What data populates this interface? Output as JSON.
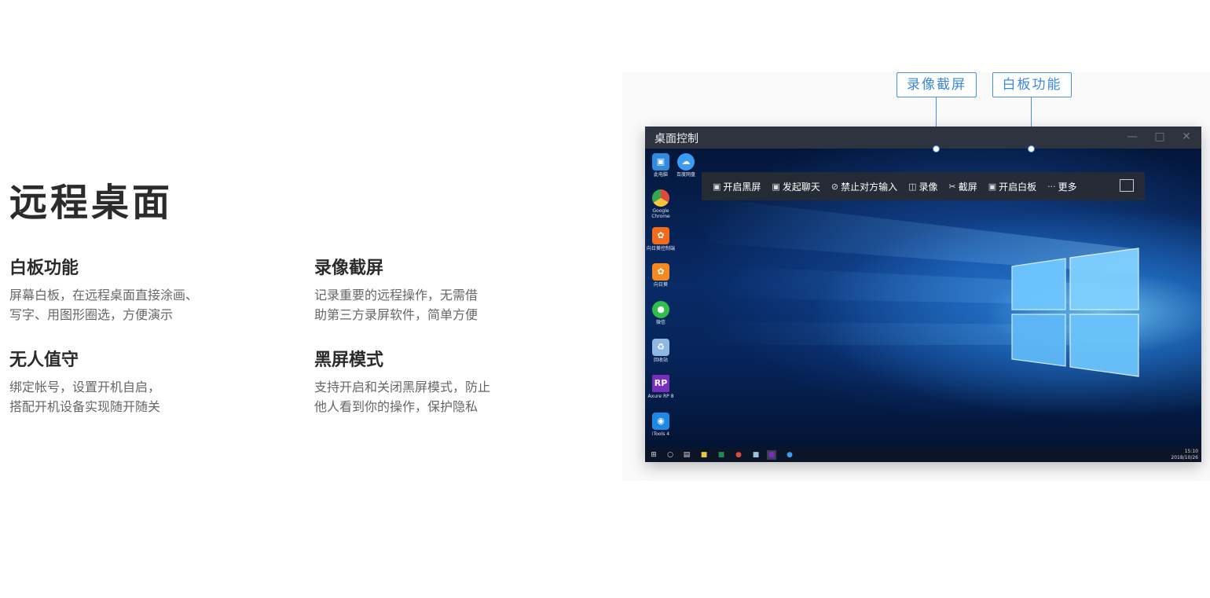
{
  "hero": {
    "title": "远程桌面"
  },
  "features": [
    {
      "title": "白板功能",
      "lines": [
        "屏幕白板，在远程桌面直接涂画、",
        "写字、用图形圈选，方便演示"
      ]
    },
    {
      "title": "录像截屏",
      "lines": [
        "记录重要的远程操作，无需借",
        "助第三方录屏软件，简单方便"
      ]
    },
    {
      "title": "无人值守",
      "lines": [
        "绑定帐号，设置开机自启，",
        "搭配开机设备实现随开随关"
      ]
    },
    {
      "title": "黑屏模式",
      "lines": [
        "支持开启和关闭黑屏模式，防止",
        "他人看到你的操作，保护隐私"
      ]
    }
  ],
  "callouts": {
    "record": "录像截屏",
    "whiteboard": "白板功能"
  },
  "window": {
    "title": "桌面控制",
    "toolbar": [
      {
        "label": "开启黑屏",
        "icon": "screen-icon"
      },
      {
        "label": "发起聊天",
        "icon": "chat-icon"
      },
      {
        "label": "禁止对方输入",
        "icon": "block-input-icon"
      },
      {
        "label": "录像",
        "icon": "camera-icon"
      },
      {
        "label": "截屏",
        "icon": "scissors-icon"
      },
      {
        "label": "开启白板",
        "icon": "whiteboard-icon"
      },
      {
        "label": "更多",
        "icon": "more-icon"
      }
    ]
  },
  "desktop_icons": [
    {
      "label": "此电脑",
      "color": "#2f8be0",
      "icon": "computer-icon"
    },
    {
      "label": "百度网盘",
      "color": "#3b9cf5",
      "icon": "cloud-icon"
    },
    {
      "label": "Google Chrome",
      "color": "#e04a3a",
      "icon": "chrome-icon"
    },
    {
      "label": "向日葵控制端",
      "color": "#f26b1d",
      "icon": "sunflower-icon"
    },
    {
      "label": "向日葵",
      "color": "#f48a1f",
      "icon": "sunflower-icon"
    },
    {
      "label": "微信",
      "color": "#2fbf4a",
      "icon": "wechat-icon"
    },
    {
      "label": "回收站",
      "color": "#8fb9e0",
      "icon": "recycle-bin-icon"
    },
    {
      "label": "Axure RP 8",
      "color": "#7a2dbd",
      "icon": "axure-icon",
      "glyph": "RP"
    },
    {
      "label": "iTools 4",
      "color": "#1e88e5",
      "icon": "itools-icon"
    }
  ],
  "taskbar": {
    "time": "15:10",
    "date": "2018/10/26"
  },
  "colors": {
    "accent": "#4a90e2",
    "toolbar_bg": "#282c34",
    "titlebar_bg": "#2e3340"
  }
}
